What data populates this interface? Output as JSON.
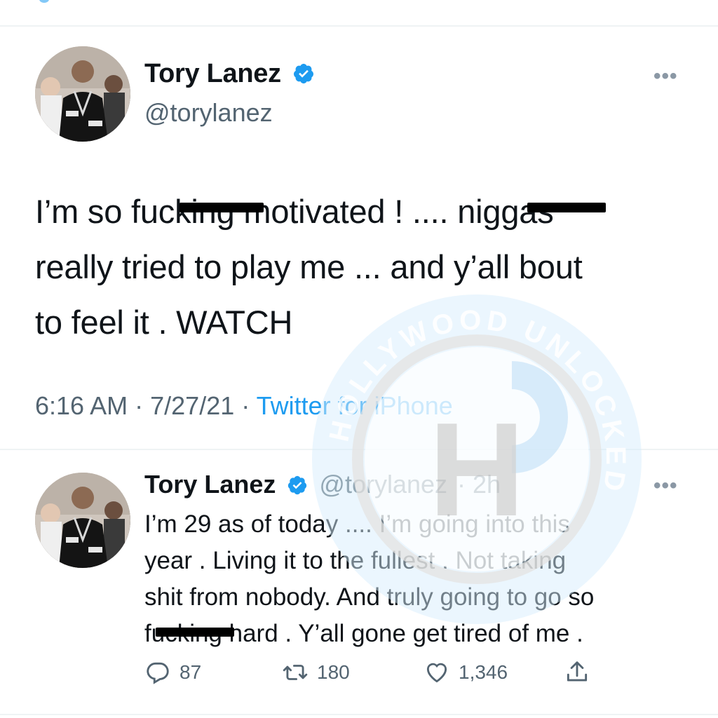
{
  "main_tweet": {
    "author_name": "Tory Lanez",
    "author_handle": "@torylanez",
    "text_lines": [
      "I’m so fucking motivated ! .... niggas",
      "really tried to play me ... and y’all bout",
      "to feel it . WATCH"
    ],
    "time": "6:16 AM",
    "date": "7/27/21",
    "separator": "·",
    "source": "Twitter for iPhone",
    "more_label": "•••"
  },
  "reply_tweet": {
    "author_name": "Tory Lanez",
    "author_handle": "@torylanez",
    "age": "· 2h",
    "text_lines": [
      "I’m 29 as of today .... I’m going into this",
      "year . Living it to the fullest . Not taking",
      "shit from nobody. And truly going to go so",
      "fucking hard . Y’all gone get tired of me ."
    ],
    "more_label": "•••",
    "replies": "87",
    "retweets": "180",
    "likes": "1,346"
  },
  "watermark": {
    "ring_text": "HOLLYWOOD UNLOCKED",
    "letter": "H"
  },
  "colors": {
    "accent": "#1d9bf0",
    "muted": "#536471",
    "text": "#0f1419",
    "redaction": "#000000"
  }
}
